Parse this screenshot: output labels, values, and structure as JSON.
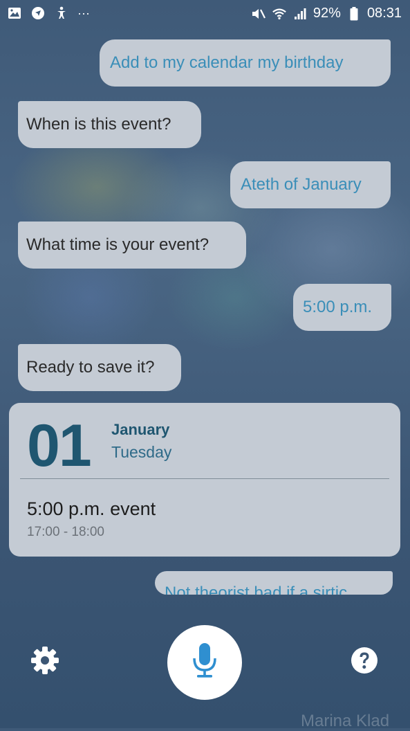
{
  "status_bar": {
    "left_icons": [
      "image-icon",
      "navigation-icon",
      "accessibility-icon",
      "more-dots-icon"
    ],
    "right_icons": [
      "mute-icon",
      "wifi-icon",
      "signal-icon",
      "battery-icon"
    ],
    "more": "···",
    "battery": "92%",
    "time": "08:31"
  },
  "conversation": {
    "messages": [
      {
        "from": "user",
        "text": "Add to my calendar my birthday"
      },
      {
        "from": "assistant",
        "text": "When is this event?"
      },
      {
        "from": "user",
        "text": "Ateth of January"
      },
      {
        "from": "assistant",
        "text": "What time is your event?"
      },
      {
        "from": "user",
        "text": "5:00 p.m."
      },
      {
        "from": "assistant",
        "text": "Ready to save it?"
      }
    ],
    "partial_message": "Not theorist bad if a sirtic"
  },
  "event_card": {
    "day": "01",
    "month": "January",
    "weekday": "Tuesday",
    "title": "5:00 p.m. event",
    "time_range": "17:00 - 18:00"
  },
  "bottom_bar": {
    "settings_icon": "gear-icon",
    "mic_icon": "microphone-icon",
    "help_icon": "help-icon",
    "accent": "#2f8fd0"
  },
  "watermark": "Marina Klad"
}
